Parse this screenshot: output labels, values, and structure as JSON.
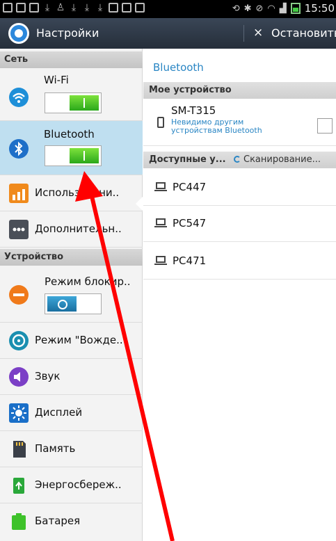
{
  "status_bar": {
    "time": "15:50"
  },
  "action_bar": {
    "title": "Настройки",
    "stop_label": "Остановить"
  },
  "left": {
    "sections": [
      {
        "label": "Сеть"
      },
      {
        "label": "Устройство"
      }
    ],
    "items": [
      {
        "label": "Wi-Fi",
        "toggle": "on"
      },
      {
        "label": "Bluetooth",
        "toggle": "on",
        "selected": true
      },
      {
        "label": "Использовани.."
      },
      {
        "label": "Дополнительн.."
      },
      {
        "label": "Режим блокир..",
        "toggle": "off"
      },
      {
        "label": "Режим \"Вожде.."
      },
      {
        "label": "Звук"
      },
      {
        "label": "Дисплей"
      },
      {
        "label": "Память"
      },
      {
        "label": "Энергосбереж.."
      },
      {
        "label": "Батарея"
      }
    ]
  },
  "right": {
    "title": "Bluetooth",
    "my_device_header": "Мое устройство",
    "my_device": {
      "name": "SM-T315",
      "subtitle": "Невидимо другим устройствам Bluetooth"
    },
    "available_header": "Доступные у...",
    "scanning": "Сканирование...",
    "devices": [
      {
        "name": "PC447"
      },
      {
        "name": "PC547"
      },
      {
        "name": "PC471"
      }
    ]
  },
  "colors": {
    "accent": "#2a86c4",
    "toggle_on": "#3fc424",
    "annotation": "#ff0000"
  }
}
